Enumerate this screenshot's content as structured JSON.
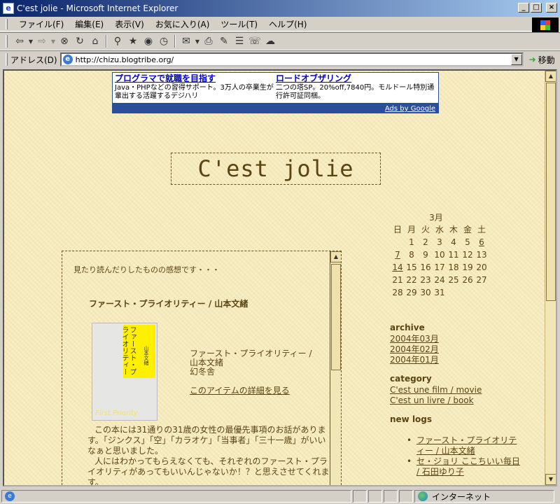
{
  "window": {
    "title": "C'est jolie - Microsoft Internet Explorer",
    "min_glyph": "_",
    "max_glyph": "□",
    "close_glyph": "×"
  },
  "menu": [
    "ファイル(F)",
    "編集(E)",
    "表示(V)",
    "お気に入り(A)",
    "ツール(T)",
    "ヘルプ(H)"
  ],
  "address": {
    "label": "アドレス(D)",
    "url": "http://chizu.blogtribe.org/",
    "go_label": "移動"
  },
  "ad": {
    "items": [
      {
        "title": "プログラマで就職を目指す",
        "text": "Java・PHPなどの習得サポート。3万人の卒業生が輩出する活躍するデジハリ"
      },
      {
        "title": "ロードオブザリング",
        "text": "二つの塔SP。20%off,7840円。モルドール特別通行許可証同梱。"
      }
    ],
    "footer": "Ads by Google"
  },
  "blog": {
    "title": "C'est jolie",
    "intro": "見たり読んだりしたものの感想です・・・",
    "post_title": "ファースト・プライオリティー / 山本文緒",
    "book_cover": {
      "title_vertical": "ファースト・プライオリティー",
      "author_vertical": "山本文緒",
      "english": "First Priority"
    },
    "book_info": {
      "line1": "ファースト・プライオリティー /",
      "line2": "山本文緒",
      "line3": "幻冬舎",
      "detail_link": "このアイテムの詳細を見る"
    },
    "paragraphs": [
      "この本には31通りの31歳の女性の最優先事項のお話があります。「ジンクス」「空」「カラオケ」「当事者」「三十一歳」がいいなぁと思いました。",
      "人にはわかってもらえなくても、それぞれのファースト・プライオリティがあってもいいんじゃないか！？と思えさせてくれます。"
    ]
  },
  "calendar": {
    "month": "3月",
    "weekdays": [
      "日",
      "月",
      "火",
      "水",
      "木",
      "金",
      "土"
    ],
    "weeks": [
      [
        "",
        "1",
        "2",
        "3",
        "4",
        "5",
        "6"
      ],
      [
        "7",
        "8",
        "9",
        "10",
        "11",
        "12",
        "13"
      ],
      [
        "14",
        "15",
        "16",
        "17",
        "18",
        "19",
        "20"
      ],
      [
        "21",
        "22",
        "23",
        "24",
        "25",
        "26",
        "27"
      ],
      [
        "28",
        "29",
        "30",
        "31",
        "",
        "",
        ""
      ]
    ],
    "linked_days": [
      "6",
      "7",
      "14"
    ]
  },
  "sidebar": {
    "archive_head": "archive",
    "archive": [
      "2004年03月",
      "2004年02月",
      "2004年01月"
    ],
    "category_head": "category",
    "category": [
      "C'est une film / movie",
      "C'est un livre / book"
    ],
    "newlogs_head": "new logs",
    "newlogs": [
      "ファースト・プライオリティー / 山本文緒",
      "セ・ジョリ ここちいい毎日 / 石田ゆり子"
    ]
  },
  "status": {
    "zone": "インターネット"
  }
}
